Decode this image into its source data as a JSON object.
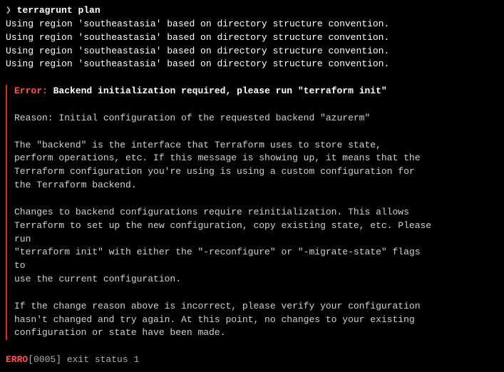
{
  "prompt": {
    "symbol": "❯",
    "command": "terragrunt plan"
  },
  "info_lines": [
    "Using region 'southeastasia' based on directory structure convention.",
    "Using region 'southeastasia' based on directory structure convention.",
    "Using region 'southeastasia' based on directory structure convention.",
    "Using region 'southeastasia' based on directory structure convention."
  ],
  "error": {
    "label": "Error:",
    "title": "Backend initialization required, please run \"terraform init\"",
    "reason": "Reason: Initial configuration of the requested backend \"azurerm\"",
    "para1": "The \"backend\" is the interface that Terraform uses to store state,\nperform operations, etc. If this message is showing up, it means that the\nTerraform configuration you're using is using a custom configuration for\nthe Terraform backend.",
    "para2": "Changes to backend configurations require reinitialization. This allows\nTerraform to set up the new configuration, copy existing state, etc. Please\nrun\n\"terraform init\" with either the \"-reconfigure\" or \"-migrate-state\" flags\nto\nuse the current configuration.",
    "para3": "If the change reason above is incorrect, please verify your configuration\nhasn't changed and try again. At this point, no changes to your existing\nconfiguration or state have been made."
  },
  "footer": {
    "erro_label": "ERRO",
    "exit": "[0005] exit status 1"
  }
}
